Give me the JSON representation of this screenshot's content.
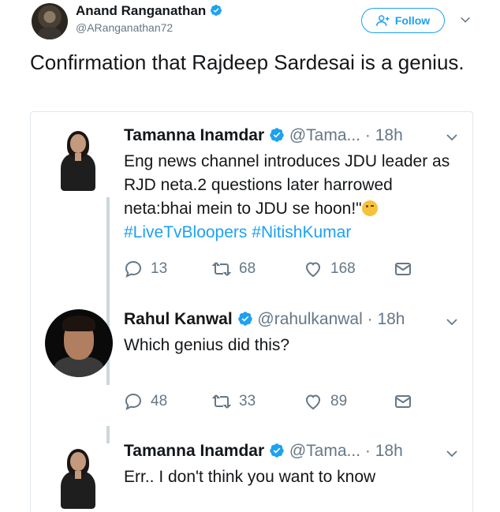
{
  "author": {
    "name": "Anand Ranganathan",
    "handle": "@ARanganathan72",
    "follow_label": "Follow"
  },
  "tweet": {
    "text": "Confirmation that Rajdeep Sardesai is a genius."
  },
  "colors": {
    "accent": "#1da1f2",
    "muted": "#657786",
    "text": "#14171a",
    "border": "#e1e8ed"
  },
  "embedded": [
    {
      "name": "Tamanna Inamdar",
      "handle": "@Tama...",
      "time": "· 18h",
      "text": "Eng news channel introduces JDU leader as RJD neta.2 questions later harrowed neta:bhai mein to JDU se hoon!\"",
      "hashtags": [
        "#LiveTvBloopers",
        "#NitishKumar"
      ],
      "replies": "13",
      "retweets": "68",
      "likes": "168"
    },
    {
      "name": "Rahul Kanwal",
      "handle": "@rahulkanwal",
      "time": "· 18h",
      "text": "Which genius did this?",
      "replies": "48",
      "retweets": "33",
      "likes": "89"
    },
    {
      "name": "Tamanna Inamdar",
      "handle": "@Tama...",
      "time": "· 18h",
      "text": "Err.. I don't think you want to know"
    }
  ],
  "icons": {
    "verified": "verified-badge-icon",
    "reply": "reply-icon",
    "retweet": "retweet-icon",
    "like": "heart-icon",
    "dm": "envelope-icon",
    "more": "chevron-down-icon",
    "follow": "add-user-icon"
  }
}
